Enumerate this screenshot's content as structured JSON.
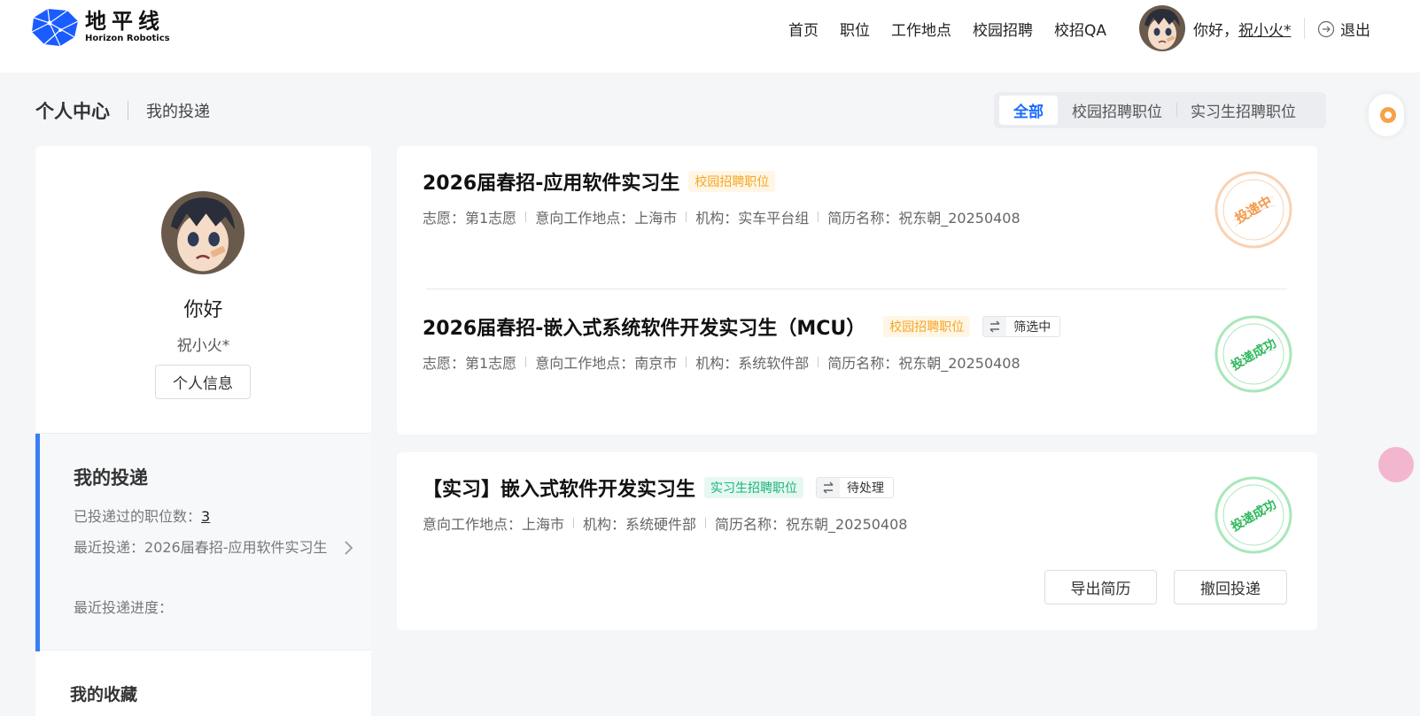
{
  "brand": {
    "name_cn": "地平线",
    "name_en": "Horizon Robotics",
    "color": "#1a5cff"
  },
  "nav": {
    "items": [
      "首页",
      "职位",
      "工作地点",
      "校园招聘",
      "校招QA"
    ],
    "greeting_prefix": "你好，",
    "username": "祝小火*",
    "logout": "退出"
  },
  "breadcrumb": {
    "main": "个人中心",
    "sub": "我的投递"
  },
  "filter": {
    "tabs": [
      "全部",
      "校园招聘职位",
      "实习生招聘职位"
    ],
    "active": "全部"
  },
  "sidebar": {
    "hello": "你好",
    "name": "祝小火*",
    "profile_button": "个人信息",
    "panel_title": "我的投递",
    "count_label": "已投递过的职位数：",
    "count": "3",
    "recent_label": "最近投递：",
    "recent_value": "2026届春招-应用软件实习生",
    "progress_label": "最近投递进度：",
    "favorites_title": "我的收藏"
  },
  "applications": [
    {
      "title": "2026届春招-应用软件实习生",
      "tag": "校园招聘职位",
      "status": "",
      "meta": [
        "志愿：第1志愿",
        "意向工作地点：上海市",
        "机构：实车平台组",
        "简历名称：祝东朝_20250408"
      ],
      "stamp": "投递中",
      "stamp_color": "#f5a25d"
    },
    {
      "title": "2026届春招-嵌入式系统软件开发实习生（MCU）",
      "tag": "校园招聘职位",
      "status": "筛选中",
      "meta": [
        "志愿：第1志愿",
        "意向工作地点：南京市",
        "机构：系统软件部",
        "简历名称：祝东朝_20250408"
      ],
      "stamp": "投递成功",
      "stamp_color": "#3cc46a"
    },
    {
      "title": "【实习】嵌入式软件开发实习生",
      "tag": "实习生招聘职位",
      "status": "待处理",
      "meta": [
        "意向工作地点：上海市",
        "机构：系统硬件部",
        "简历名称：祝东朝_20250408"
      ],
      "stamp": "投递成功",
      "stamp_color": "#3cc46a",
      "actions": [
        "导出简历",
        "撤回投递"
      ]
    }
  ]
}
